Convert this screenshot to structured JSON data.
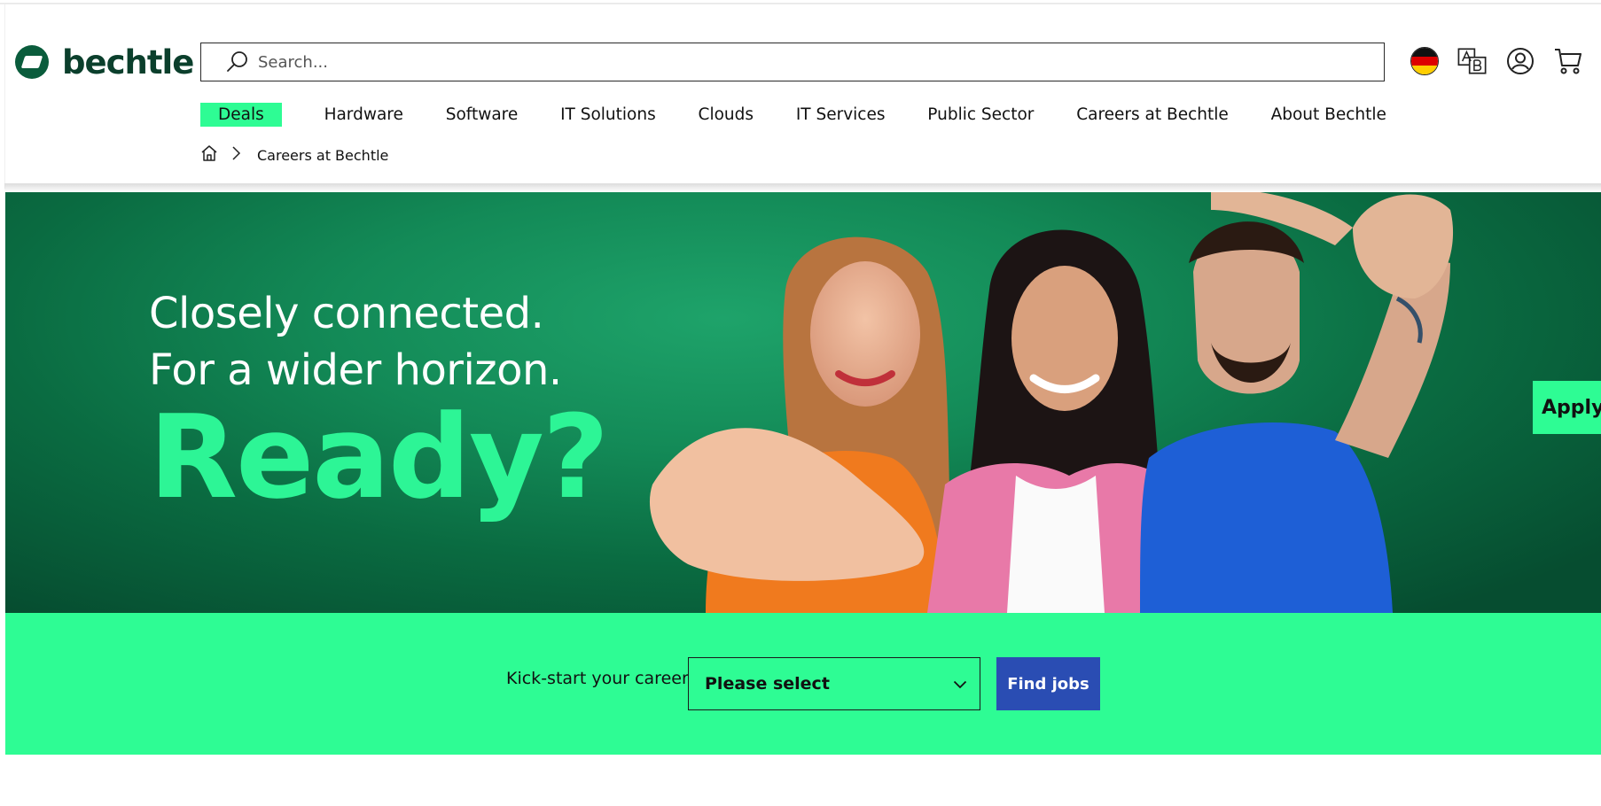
{
  "brand": {
    "name": "bechtle"
  },
  "search": {
    "placeholder": "Search..."
  },
  "header_icons": [
    "germany-flag-icon",
    "language-icon",
    "account-icon",
    "cart-icon"
  ],
  "nav": {
    "items": [
      "Deals",
      "Hardware",
      "Software",
      "IT Solutions",
      "Clouds",
      "IT Services",
      "Public Sector",
      "Careers at Bechtle",
      "About Bechtle"
    ]
  },
  "breadcrumb": {
    "current": "Careers at Bechtle"
  },
  "hero": {
    "line1": "Closely connected.",
    "line2": "For a wider horizon.",
    "headline": "Ready?",
    "apply_tab": "Apply"
  },
  "career": {
    "label": "Kick-start your career",
    "select_value": "Please select",
    "button": "Find jobs"
  },
  "colors": {
    "accent_green": "#2efc94",
    "brand_dark_green": "#0b3f2c",
    "button_blue": "#2a4db3",
    "hero_green": "#138a57"
  }
}
